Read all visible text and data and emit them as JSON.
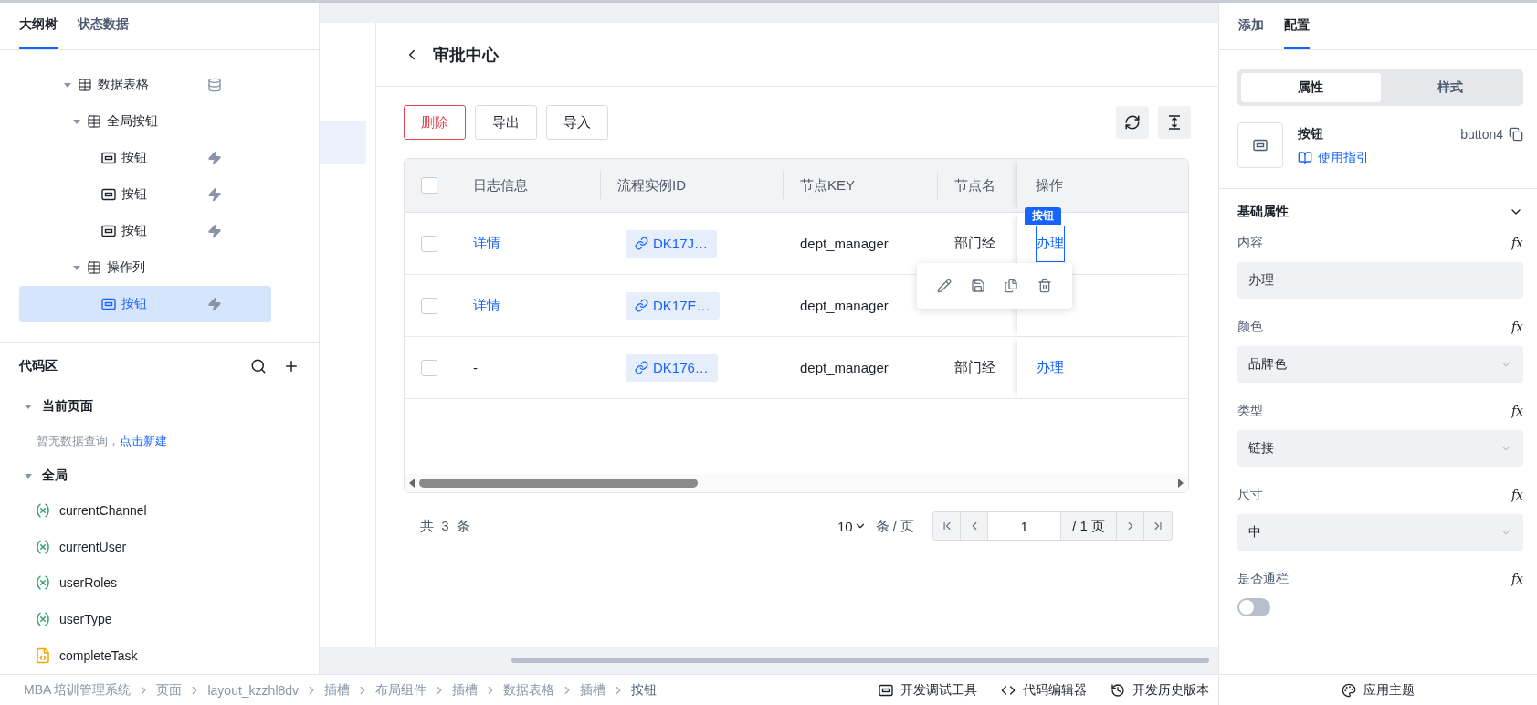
{
  "left_panel": {
    "tabs": [
      {
        "label": "大纲树",
        "selected": true
      },
      {
        "label": "状态数据",
        "selected": false
      }
    ],
    "outline_tree": [
      {
        "label": "数据表格",
        "kind": "data_table",
        "expanded": true,
        "selected": false,
        "children": [
          {
            "label": "全局按钮",
            "kind": "column_group",
            "expanded": true,
            "selected": false,
            "children": [
              {
                "label": "按钮",
                "kind": "button",
                "selected": false
              },
              {
                "label": "按钮",
                "kind": "button",
                "selected": false
              },
              {
                "label": "按钮",
                "kind": "button",
                "selected": false
              }
            ]
          },
          {
            "label": "操作列",
            "kind": "column_group",
            "expanded": true,
            "selected": false,
            "children": [
              {
                "label": "按钮",
                "kind": "button",
                "selected": true
              }
            ]
          }
        ]
      }
    ],
    "code_area": {
      "title": "代码区",
      "sections": [
        {
          "title": "当前页面",
          "expanded": true,
          "empty_text": "暂无数据查询，",
          "empty_link": "点击新建"
        },
        {
          "title": "全局",
          "expanded": true,
          "items": [
            {
              "name": "currentChannel",
              "kind": "variable"
            },
            {
              "name": "currentUser",
              "kind": "variable"
            },
            {
              "name": "userRoles",
              "kind": "variable"
            },
            {
              "name": "userType",
              "kind": "variable"
            },
            {
              "name": "completeTask",
              "kind": "script"
            }
          ]
        }
      ]
    }
  },
  "canvas": {
    "page_title": "审批中心",
    "toolbar_buttons": [
      {
        "label": "删除",
        "kind": "danger"
      },
      {
        "label": "导出",
        "kind": "default"
      },
      {
        "label": "导入",
        "kind": "default"
      }
    ],
    "table": {
      "columns": [
        "日志信息",
        "流程实例ID",
        "节点KEY",
        "节点名",
        "操作"
      ],
      "rows": [
        {
          "checked": false,
          "log": {
            "label": "详情",
            "kind": "link"
          },
          "instance_id": "DK17J…",
          "node_key": "dept_manager",
          "node_name": "部门经",
          "action": "办理"
        },
        {
          "checked": false,
          "log": {
            "label": "详情",
            "kind": "link"
          },
          "instance_id": "DK17E…",
          "node_key": "dept_manager"
        },
        {
          "checked": false,
          "log": {
            "label": "-",
            "kind": "text"
          },
          "instance_id": "DK176…",
          "node_key": "dept_manager",
          "node_name": "部门经",
          "action": "办理"
        }
      ],
      "select_all_checked": false,
      "selection_tag": "按钮"
    },
    "pagination": {
      "total": "共 3 条",
      "page_size": "10",
      "page_size_unit": "条 / 页",
      "page": "1",
      "page_total": "/ 1 页"
    }
  },
  "breadcrumb": [
    "MBA 培训管理系统",
    "页面",
    "layout_kzzhl8dv",
    "插槽",
    "布局组件",
    "插槽",
    "数据表格",
    "插槽",
    "按钮"
  ],
  "footer_tools": [
    {
      "label": "开发调试工具",
      "kind": "debug"
    },
    {
      "label": "代码编辑器",
      "kind": "code"
    },
    {
      "label": "开发历史版本",
      "kind": "history"
    }
  ],
  "right_panel": {
    "tabs": [
      {
        "label": "添加",
        "selected": false
      },
      {
        "label": "配置",
        "selected": true
      }
    ],
    "segments": [
      {
        "label": "属性",
        "selected": true
      },
      {
        "label": "样式",
        "selected": false
      }
    ],
    "component": {
      "name": "按钮",
      "guide_link": "使用指引",
      "id": "button4"
    },
    "section_title": "基础属性",
    "fields": [
      {
        "label": "内容",
        "kind": "input",
        "value": "办理",
        "fx": "fx"
      },
      {
        "label": "颜色",
        "kind": "select",
        "value": "品牌色",
        "fx": "fx"
      },
      {
        "label": "类型",
        "kind": "select",
        "value": "链接",
        "fx": "fx"
      },
      {
        "label": "尺寸",
        "kind": "select",
        "value": "中",
        "fx": "fx"
      },
      {
        "label": "是否通栏",
        "kind": "switch",
        "on": false,
        "fx": "fx"
      }
    ],
    "theme_button": "应用主题"
  }
}
